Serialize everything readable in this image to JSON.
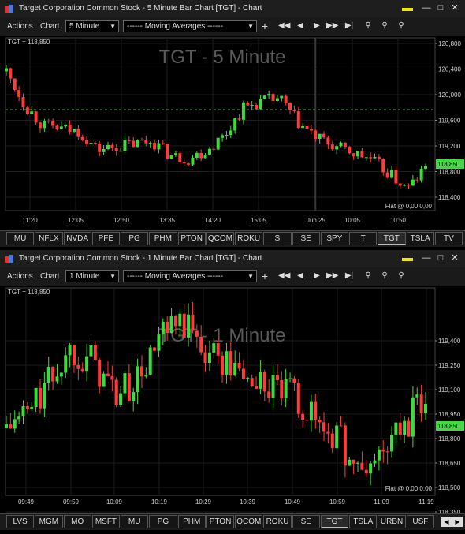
{
  "windows": [
    {
      "title": "Target Corporation Common Stock - 5 Minute Bar Chart [TGT] - Chart",
      "menu": [
        "Actions",
        "Chart"
      ],
      "interval": "5 Minute",
      "indicator": "------  Moving Averages  ------",
      "chart_title": "TGT - 5 Minute",
      "last_label": "TGT = 118,850",
      "price_tag": "118,850",
      "position_text": "Flat @ 0,00   0,00",
      "y_ticks": [
        "120,800",
        "120,400",
        "120,000",
        "119,600",
        "119,200",
        "118,800",
        "118,400"
      ],
      "x_ticks": [
        "11:20",
        "12:05",
        "12:50",
        "13:35",
        "14:20",
        "15:05",
        "Jun 25",
        "10:05",
        "10:50"
      ],
      "tabs": [
        "MU",
        "NFLX",
        "NVDA",
        "PFE",
        "PG",
        "PHM",
        "PTON",
        "QCOM",
        "ROKU",
        "S",
        "SE",
        "SPY",
        "T",
        "TGT",
        "TSLA",
        "TV"
      ],
      "active_tab": "TGT"
    },
    {
      "title": "Target Corporation Common Stock - 1 Minute Bar Chart [TGT] - Chart",
      "menu": [
        "Actions",
        "Chart"
      ],
      "interval": "1 Minute",
      "indicator": "------  Moving Averages  ------",
      "chart_title": "TGT - 1 Minute",
      "last_label": "TGT = 118,850",
      "price_tag": "118,850",
      "position_text": "Flat @ 0,00   0,00",
      "y_ticks": [
        "119,400",
        "119,250",
        "119,100",
        "118,950",
        "118,800",
        "118,650",
        "118,500",
        "118,350"
      ],
      "x_ticks": [
        "09:49",
        "09:59",
        "10:09",
        "10:19",
        "10:29",
        "10:39",
        "10:49",
        "10:59",
        "11:09",
        "11:19"
      ],
      "tabs": [
        "LVS",
        "MGM",
        "MO",
        "MSFT",
        "MU",
        "PG",
        "PHM",
        "PTON",
        "QCOM",
        "ROKU",
        "SE",
        "TGT",
        "TSLA",
        "URBN",
        "USF"
      ],
      "active_tab": "TGT"
    }
  ],
  "toolbar_icons": [
    "plus-icon",
    "skip-start-icon",
    "step-back-icon",
    "play-icon",
    "fast-forward-icon",
    "skip-end-icon",
    "zoom-icon",
    "zoom-in-icon",
    "zoom-out-icon"
  ],
  "colors": {
    "up": "#3ddc3d",
    "down": "#ff3b3b",
    "price_tag": "#3ddc3d",
    "ref_line": "#2fb52f",
    "background": "#000000"
  }
}
